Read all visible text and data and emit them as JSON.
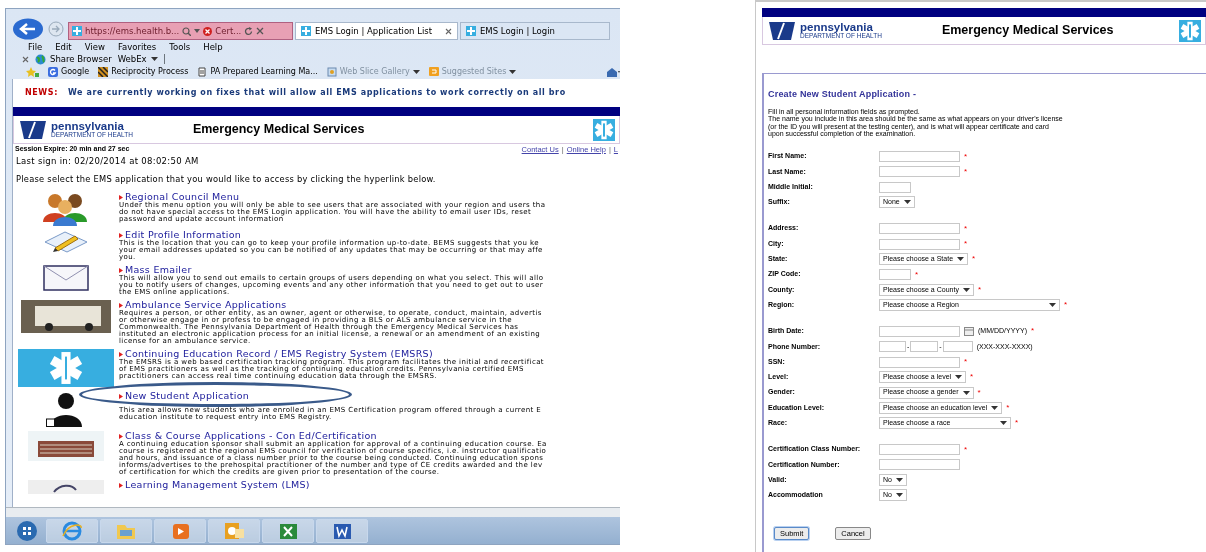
{
  "browser": {
    "address": "https://ems.health.b...",
    "cert_label": "Cert...",
    "tabs": [
      {
        "label": "EMS Login | Application List",
        "selected": true
      },
      {
        "label": "EMS Login | Login",
        "selected": false
      }
    ],
    "menu": [
      "File",
      "Edit",
      "View",
      "Favorites",
      "Tools",
      "Help"
    ],
    "toolbar": [
      {
        "label": "Share Browser",
        "dropdown": false
      },
      {
        "label": "WebEx",
        "dropdown": true
      }
    ],
    "favorites": [
      {
        "kind": "google",
        "label": "Google",
        "dropdown": false,
        "dimmed": false
      },
      {
        "kind": "flag",
        "label": "Reciprocity Process",
        "dropdown": false,
        "dimmed": false
      },
      {
        "kind": "page",
        "label": "PA Prepared Learning Ma...",
        "dropdown": false,
        "dimmed": false
      },
      {
        "kind": "slice",
        "label": "Web Slice Gallery",
        "dropdown": true,
        "dimmed": true
      },
      {
        "kind": "sites",
        "label": "Suggested Sites",
        "dropdown": true,
        "dimmed": true
      }
    ]
  },
  "news": {
    "label": "NEWS:",
    "text": "We are currently working on fixes that will allow all EMS applications to work correctly on all bro"
  },
  "header": {
    "state": "pennsylvania",
    "department": "DEPARTMENT OF HEALTH",
    "title": "Emergency Medical Services"
  },
  "session": {
    "expire": "Session Expire: 20 min and 27 sec",
    "links": [
      "Contact Us",
      "Online Help",
      "L"
    ],
    "separator": "|",
    "last_sign_in": "Last sign in: 02/20/2014 at 08:02:50 AM"
  },
  "instruction": "Please select the EMS application that you would like to access by clicking the hyperlink below.",
  "applications": [
    {
      "kind": "people",
      "title": "Regional Council Menu",
      "highlighted": false,
      "lines": [
        "Under this menu option you will only be able to see users that are associated with your region and users tha",
        "do not have special access to the EMS Login application.  You will have the ability to email user IDs, reset",
        "password and update account information"
      ]
    },
    {
      "kind": "pencil",
      "title": "Edit Profile Information",
      "highlighted": false,
      "lines": [
        "This is the location that you can go to keep your profile information up-to-date.  BEMS suggests that you ke",
        "your email addresses updated so you can be notified of any updates that may be occurring or that may affe",
        "you."
      ]
    },
    {
      "kind": "envelope",
      "title": "Mass Emailer",
      "highlighted": false,
      "lines": [
        "This will allow you to send out emails to certain groups of users depending on what you select. This will allo",
        "you to notify users of changes, upcoming events and any other information that you need to get out to user",
        "the EMS online applications."
      ]
    },
    {
      "kind": "ambulance",
      "title": "Ambulance Service Applications",
      "highlighted": false,
      "lines": [
        "Requires a person, or other entity, as an owner, agent or otherwise, to operate, conduct, maintain, advertis",
        "or otherwise engage in or profess to be engaged in providing a BLS or ALS ambulance service in the",
        "Commonwealth. The Pennsylvania Department of Health through the Emergency Medical Services has",
        "instituted an electronic application process for an initial license, a renewal or an amendment of an existing",
        "license for an ambulance service."
      ]
    },
    {
      "kind": "star",
      "title": "Continuing Education Record / EMS Registry System (EMSRS)",
      "highlighted": false,
      "lines": [
        "The EMSRS is a web based certification tracking program.  This program facilitates the initial and recertificat",
        "of EMS practitioners as well as the tracking of continuing education credits.  Pennsylvania certified EMS",
        "practitioners can access real time continuing education data through the EMSRS."
      ]
    },
    {
      "kind": "student",
      "title": "New Student Application",
      "highlighted": true,
      "lines": [
        "This area allows new students who are enrolled in an EMS Certification program offered through a current E",
        "education institute to request entry into EMS Registry."
      ]
    },
    {
      "kind": "building",
      "title": "Class & Course Applications - Con Ed/Certification",
      "highlighted": false,
      "lines": [
        "A continuing education sponsor shall submit an application for approval of a continuing education course. Ea",
        "course is registered at the regional EMS council for verification of course specifics, i.e. instructor qualificatio",
        "and hours, and issuance of a class number prior to the course being conducted. Continuing education spons",
        "informs/advertises to the prehospital practitioner of the number and type of CE credits awarded and the lev",
        "of certification for which the credits are given prior to presentation of the course."
      ]
    },
    {
      "kind": "lms",
      "title": "Learning Management System (LMS)",
      "highlighted": false
    }
  ],
  "form_header": {
    "state": "pennsylvania",
    "department": "DEPARTMENT OF HEALTH",
    "title": "Emergency Medical Services"
  },
  "form": {
    "title": "Create New Student Application -",
    "required_mark": "*",
    "intro": [
      "Fill in all personal information fields as prompted.",
      "The name you include in this area should be the same as what appears on your driver's license",
      "(or the ID you will present at the testing center), and is what will appear certificate and card",
      "upon successful completion of the examination."
    ],
    "groups": [
      [
        {
          "label": "First Name:",
          "kind": "text",
          "required": true
        },
        {
          "label": "Last Name:",
          "kind": "text",
          "required": true
        },
        {
          "label": "Middle Initial:",
          "kind": "short_text",
          "required": false
        },
        {
          "label": "Suffix:",
          "kind": "select",
          "value": "None",
          "required": false
        }
      ],
      [
        {
          "label": "Address:",
          "kind": "text",
          "required": true
        },
        {
          "label": "City:",
          "kind": "text",
          "required": true
        },
        {
          "label": "State:",
          "kind": "select",
          "value": "Please choose a State",
          "required": true
        },
        {
          "label": "ZIP Code:",
          "kind": "short_text",
          "required": true
        },
        {
          "label": "County:",
          "kind": "select",
          "value": "Please choose a County",
          "required": true
        },
        {
          "label": "Region:",
          "kind": "long_select",
          "value": "Please choose a Region",
          "required": true
        }
      ],
      [
        {
          "label": "Birth Date:",
          "kind": "date",
          "hint": "(MM/DD/YYYY)",
          "required": true
        },
        {
          "label": "Phone Number:",
          "kind": "phone",
          "separator": "-",
          "hint": "(XXX-XXX-XXXX)",
          "required": false
        },
        {
          "label": "SSN:",
          "kind": "text",
          "required": true
        },
        {
          "label": "Level:",
          "kind": "select",
          "value": "Please choose a level",
          "required": true
        },
        {
          "label": "Gender:",
          "kind": "select",
          "value": "Please choose a gender",
          "required": true
        },
        {
          "label": "Education Level:",
          "kind": "select",
          "value": "Please choose an education level",
          "required": true
        },
        {
          "label": "Race:",
          "kind": "wide_select",
          "value": "Please choose a race",
          "required": true
        }
      ],
      [
        {
          "label": "Certification Class Number:",
          "kind": "text",
          "required": true
        },
        {
          "label": "Certification Number:",
          "kind": "text",
          "required": false
        },
        {
          "label": "Valid:",
          "kind": "select",
          "value": "No",
          "required": false
        },
        {
          "label": "Accommodation",
          "kind": "select",
          "value": "No",
          "required": false
        }
      ]
    ],
    "buttons": [
      {
        "label": "Submit",
        "primary": true
      },
      {
        "label": "Cancel",
        "primary": false
      }
    ]
  }
}
